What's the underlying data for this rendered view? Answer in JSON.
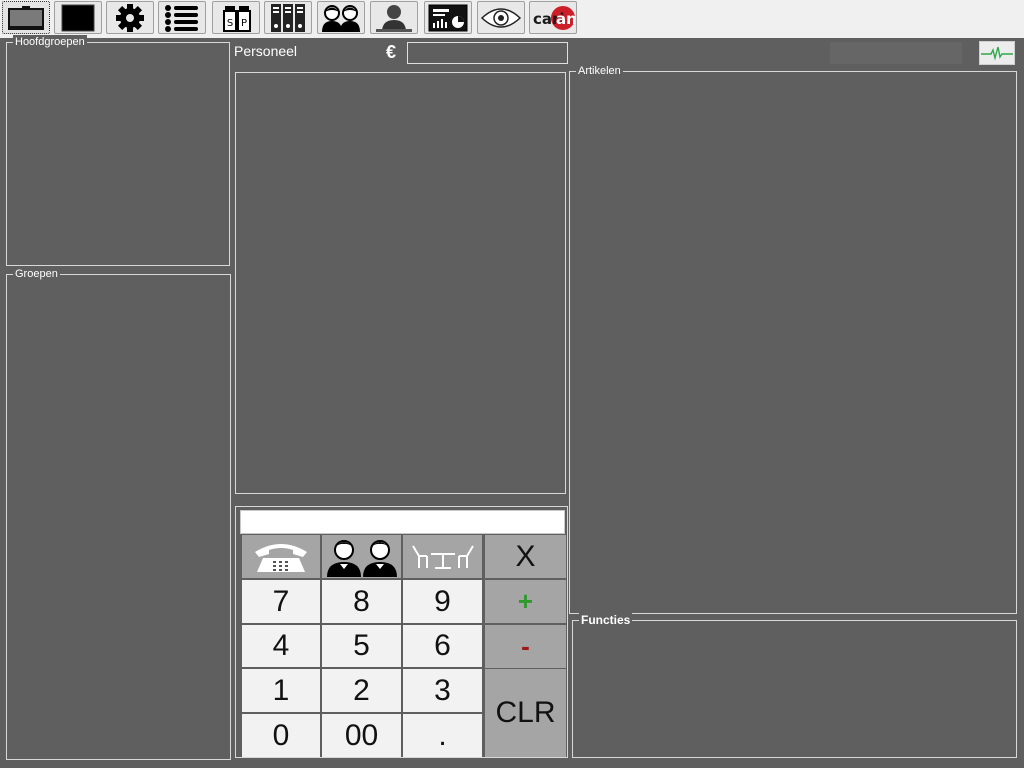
{
  "toolbar": {
    "buttons": [
      {
        "name": "monitor-button",
        "icon": "monitor-icon",
        "active": true
      },
      {
        "name": "screen-button",
        "icon": "black-screen-icon"
      },
      {
        "name": "settings-button",
        "icon": "gear-icon"
      },
      {
        "name": "list-button",
        "icon": "list-icon"
      },
      {
        "name": "salt-pepper-button",
        "icon": "salt-pepper-icon"
      },
      {
        "name": "archive-button",
        "icon": "binders-icon"
      },
      {
        "name": "staff-button",
        "icon": "people-icon"
      },
      {
        "name": "user-button",
        "icon": "person-icon"
      },
      {
        "name": "report-button",
        "icon": "report-icon"
      },
      {
        "name": "view-button",
        "icon": "eye-icon"
      },
      {
        "name": "carian-button",
        "icon": "carian-logo",
        "logo_text": "carian"
      }
    ]
  },
  "panels": {
    "hoofdgroepen": "Hoofdgroepen",
    "groepen": "Groepen",
    "personeel": "Personeel",
    "artikelen": "Artikelen",
    "functies": "Functies"
  },
  "amount": {
    "currency_symbol": "€",
    "value": ""
  },
  "keypad": {
    "display_value": "",
    "icon_keys": [
      "phone-icon",
      "waiters-icon",
      "table-icon"
    ],
    "clear_entry": "X",
    "plus": "+",
    "minus": "-",
    "clear_all": "CLR",
    "digits": [
      "7",
      "8",
      "9",
      "4",
      "5",
      "6",
      "1",
      "2",
      "3",
      "0",
      "00",
      "."
    ]
  },
  "colors": {
    "workspace": "#5f5f5f",
    "plus": "#2e9a2e",
    "minus": "#a01818",
    "heartbeat": "#2ea84a"
  }
}
